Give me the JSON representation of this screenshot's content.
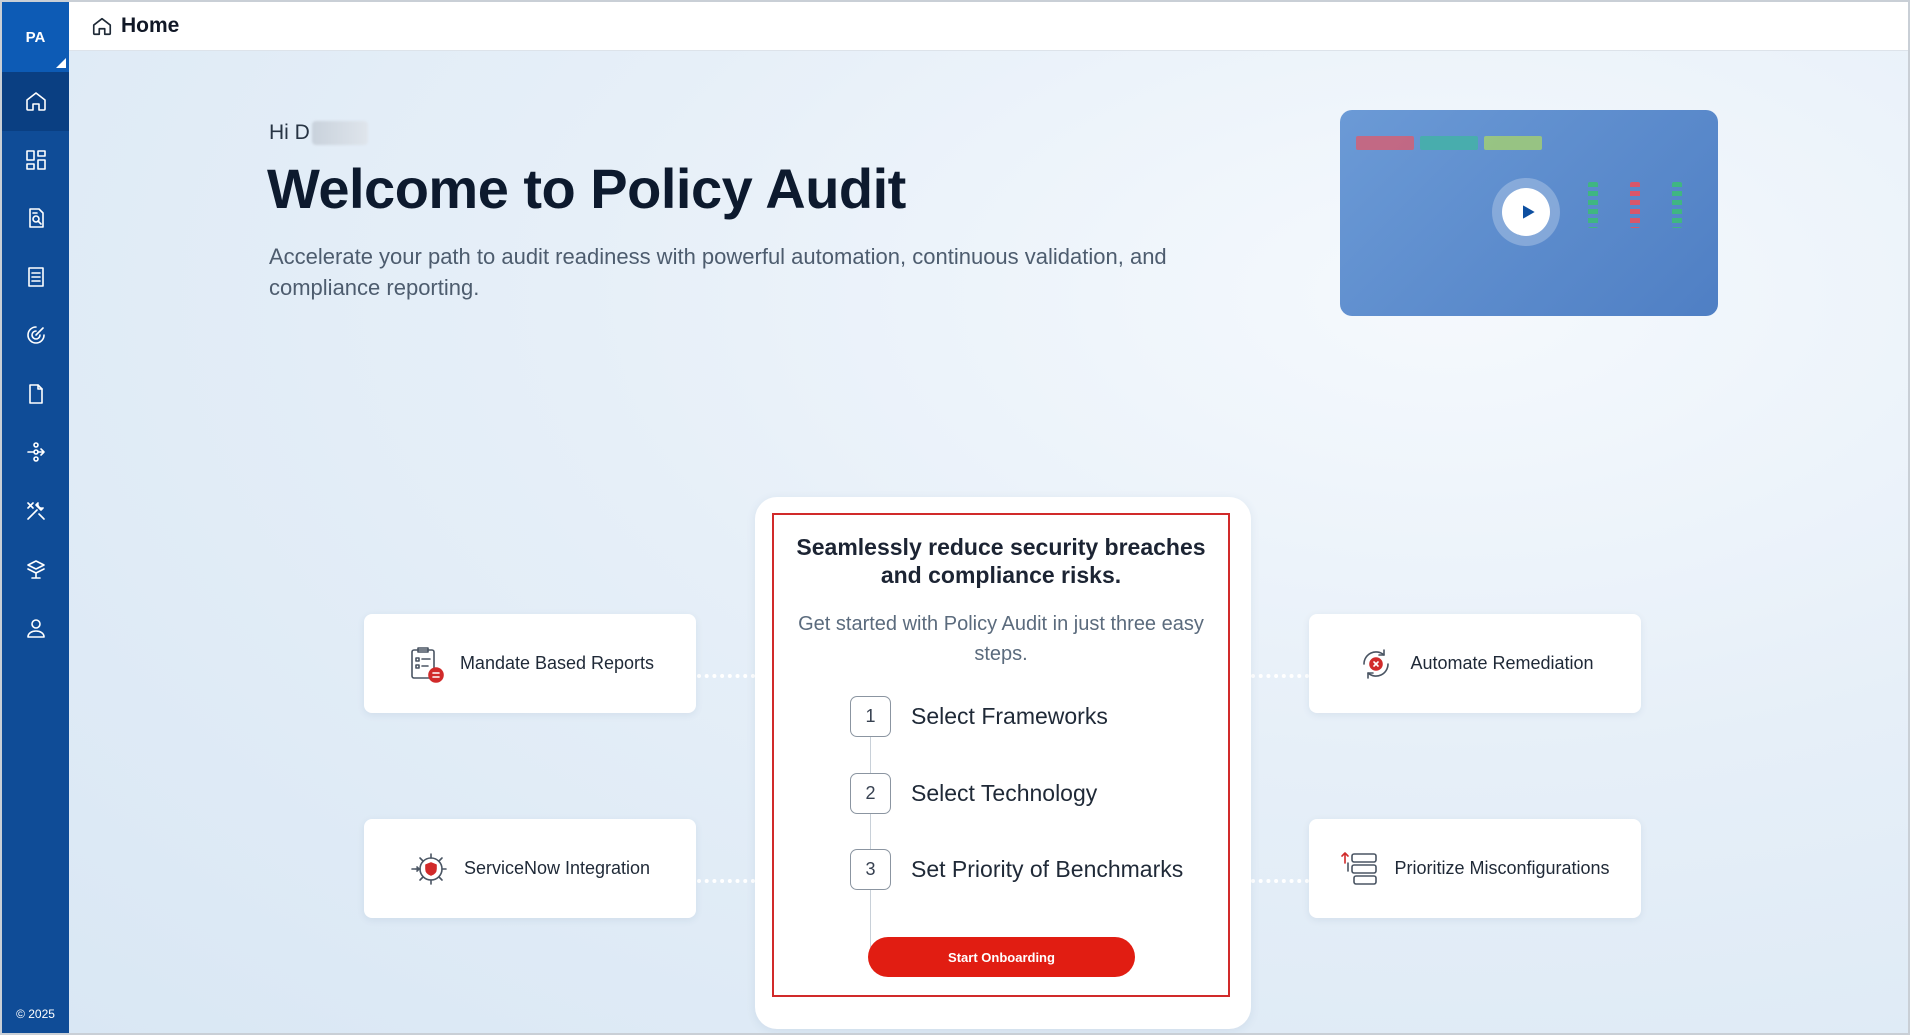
{
  "app": {
    "badge": "PA",
    "copyright": "© 2025"
  },
  "sidebar": {
    "items": [
      {
        "name": "home",
        "icon": "home-icon",
        "active": true
      },
      {
        "name": "dashboard",
        "icon": "dashboard-icon"
      },
      {
        "name": "reports",
        "icon": "report-search-icon"
      },
      {
        "name": "policies",
        "icon": "document-list-icon"
      },
      {
        "name": "scans",
        "icon": "radar-icon"
      },
      {
        "name": "documents",
        "icon": "file-icon"
      },
      {
        "name": "integrations",
        "icon": "connections-icon"
      },
      {
        "name": "tools",
        "icon": "tools-icon"
      },
      {
        "name": "assets",
        "icon": "layers-icon"
      },
      {
        "name": "users",
        "icon": "user-icon"
      }
    ]
  },
  "header": {
    "title": "Home"
  },
  "hero": {
    "greeting": "Hi D",
    "title": "Welcome to Policy Audit",
    "subtitle": "Accelerate your path to audit readiness with powerful automation, continuous validation, and compliance reporting."
  },
  "features": {
    "mandate": "Mandate Based Reports",
    "servicenow": "ServiceNow Integration",
    "remediation": "Automate Remediation",
    "misconfig": "Prioritize Misconfigurations"
  },
  "onboarding": {
    "title": "Seamlessly reduce security breaches and compliance risks.",
    "subtitle": "Get started with Policy Audit in just three easy steps.",
    "steps": [
      {
        "number": "1",
        "label": "Select Frameworks"
      },
      {
        "number": "2",
        "label": "Select Technology"
      },
      {
        "number": "3",
        "label": "Set Priority of Benchmarks"
      }
    ],
    "cta": "Start Onboarding"
  },
  "colors": {
    "sidebar": "#0f4c97",
    "accent_red": "#e11d12",
    "panel_border": "#d12a2a"
  }
}
